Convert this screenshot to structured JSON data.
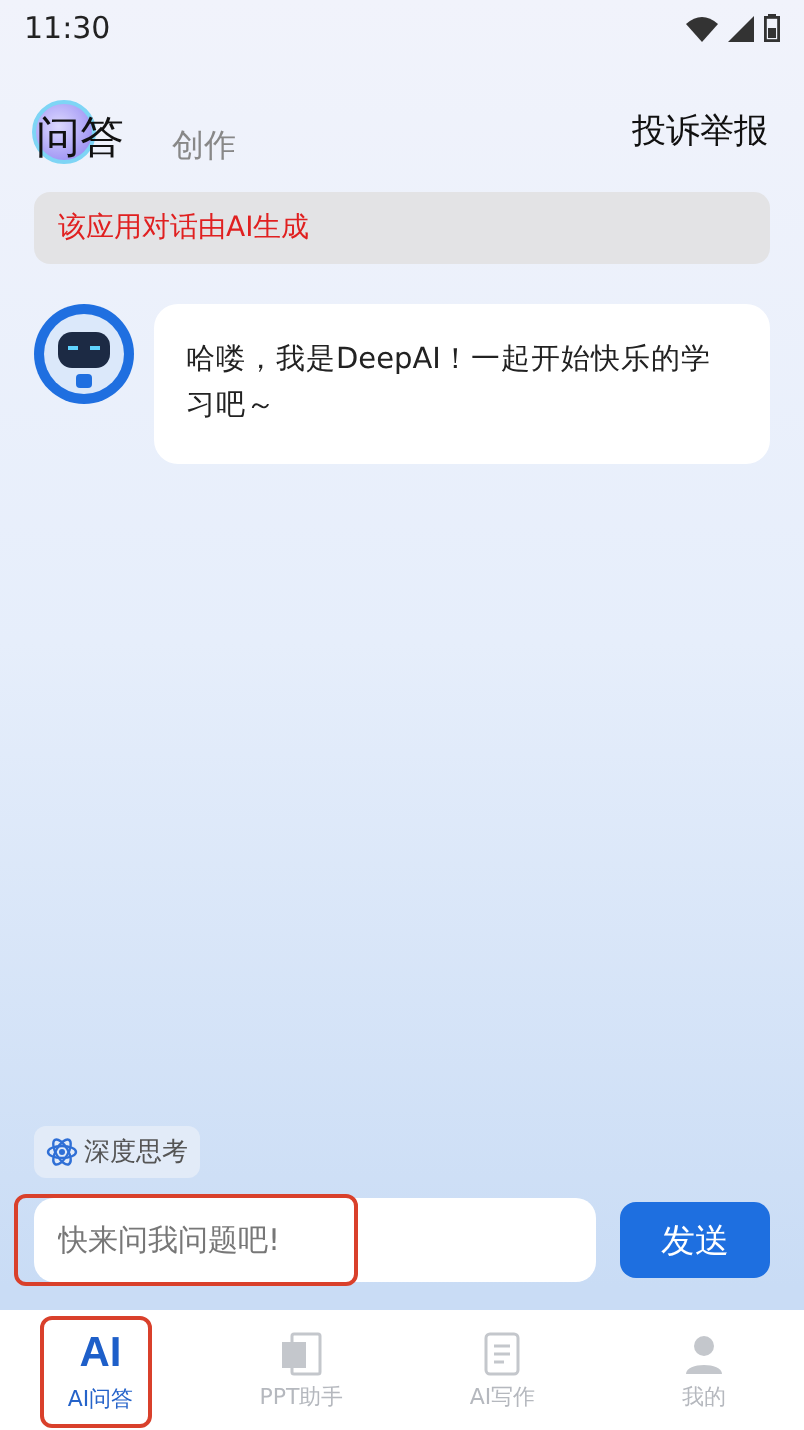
{
  "status_bar": {
    "time": "11:30"
  },
  "header": {
    "tabs": [
      {
        "label": "问答",
        "selected": true
      },
      {
        "label": "创作",
        "selected": false
      }
    ],
    "action": "投诉举报"
  },
  "notice": "该应用对话由AI生成",
  "messages": [
    {
      "text": "哈喽，我是DeepAI！一起开始快乐的学习吧～"
    }
  ],
  "composer": {
    "chip": "深度思考",
    "placeholder": "快来问我问题吧!",
    "send": "发送"
  },
  "tab_bar": [
    {
      "kind": "text",
      "icon_text": "AI",
      "label": "AI问答",
      "selected": true
    },
    {
      "kind": "ppt",
      "label": "PPT助手",
      "selected": false
    },
    {
      "kind": "doc",
      "label": "AI写作",
      "selected": false
    },
    {
      "kind": "person",
      "label": "我的",
      "selected": false
    }
  ]
}
